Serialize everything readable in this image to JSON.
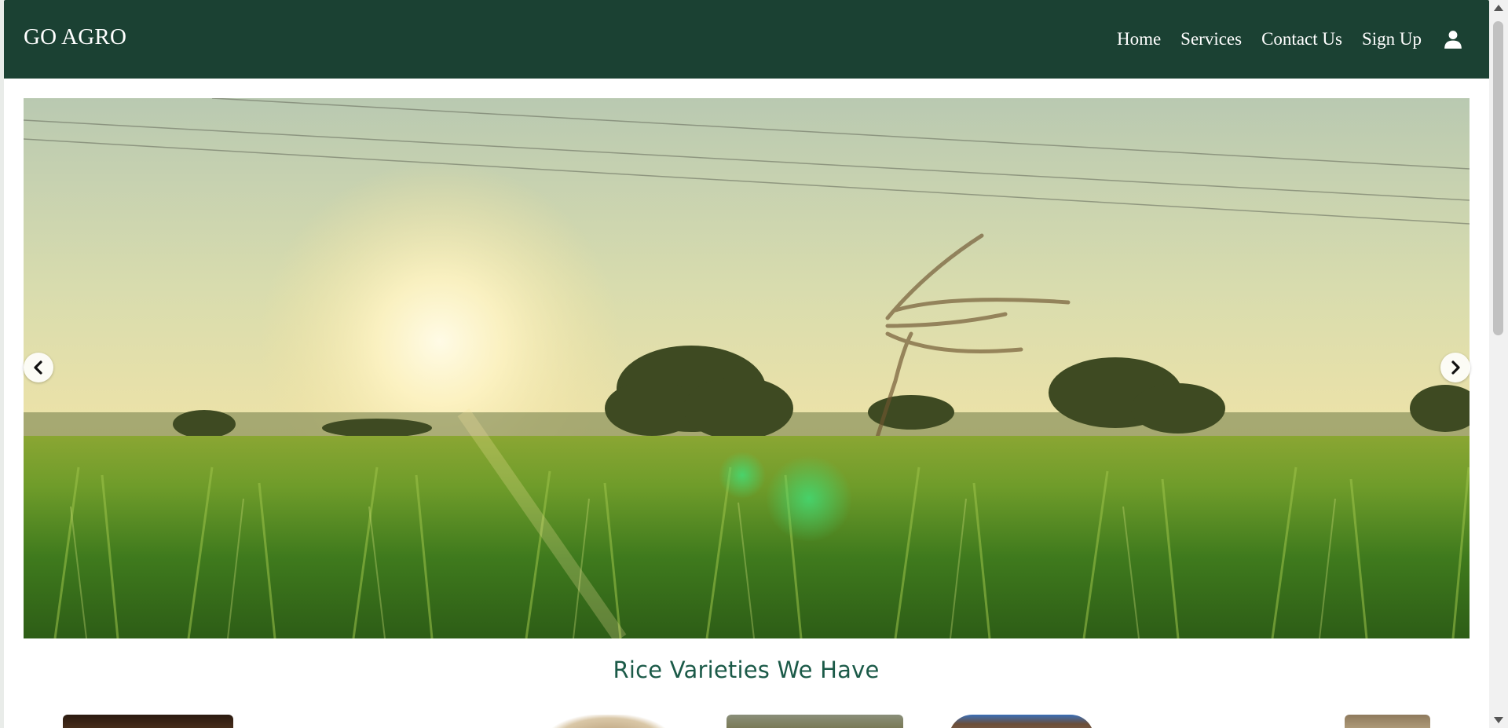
{
  "navbar": {
    "brand": "GO AGRO",
    "links": [
      "Home",
      "Services",
      "Contact Us",
      "Sign Up"
    ],
    "user_icon": "user-icon",
    "background": "#1b4133"
  },
  "hero": {
    "image": "rice-field-sunset-photo",
    "prev_icon": "chevron-left-icon",
    "next_icon": "chevron-right-icon"
  },
  "section": {
    "title": "Rice Varieties We Have",
    "title_color": "#1b5a48"
  },
  "varieties": {
    "thumbnails": [
      "rice-thumbnail",
      "rice-thumbnail",
      "rice-thumbnail",
      "rice-thumbnail",
      "rice-thumbnail"
    ]
  }
}
